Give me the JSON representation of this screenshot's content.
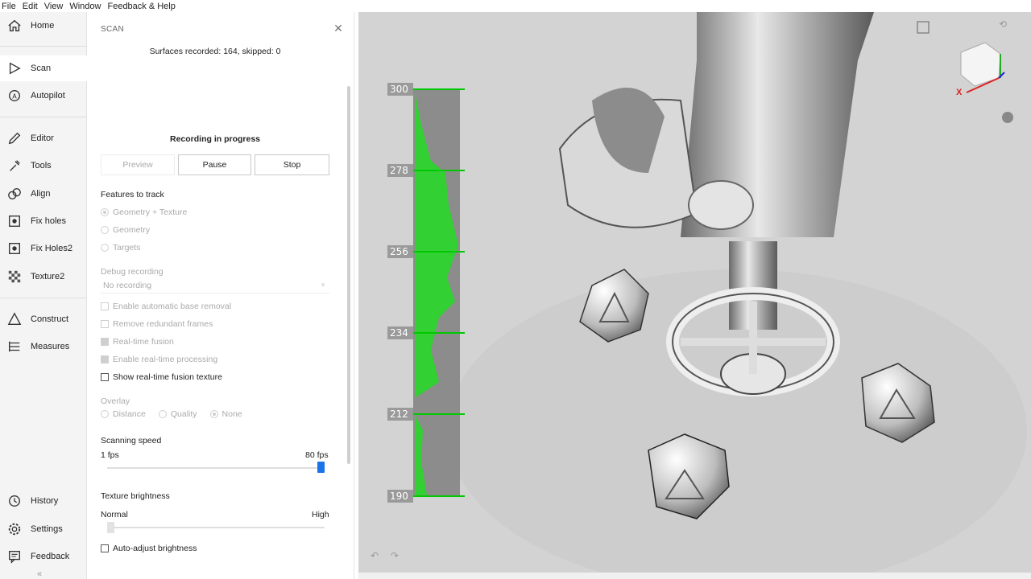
{
  "menu": {
    "file": "File",
    "edit": "Edit",
    "view": "View",
    "window": "Window",
    "help": "Feedback & Help"
  },
  "sidebar": {
    "items": [
      {
        "label": "Home",
        "icon": "home-icon"
      },
      {
        "label": "Scan",
        "icon": "play-icon"
      },
      {
        "label": "Autopilot",
        "icon": "autopilot-icon"
      },
      {
        "label": "Editor",
        "icon": "pencil-icon"
      },
      {
        "label": "Tools",
        "icon": "tools-icon"
      },
      {
        "label": "Align",
        "icon": "align-icon"
      },
      {
        "label": "Fix holes",
        "icon": "fix-holes-icon"
      },
      {
        "label": "Fix Holes2",
        "icon": "fix-holes2-icon"
      },
      {
        "label": "Texture2",
        "icon": "texture-icon"
      },
      {
        "label": "Construct",
        "icon": "construct-icon"
      },
      {
        "label": "Measures",
        "icon": "measures-icon"
      },
      {
        "label": "History",
        "icon": "history-icon"
      },
      {
        "label": "Settings",
        "icon": "gear-icon"
      },
      {
        "label": "Feedback",
        "icon": "feedback-icon"
      }
    ],
    "collapse": "«"
  },
  "panel": {
    "title": "SCAN",
    "surfaces": "Surfaces recorded: 164, skipped: 0",
    "status": "Recording in progress",
    "buttons": {
      "preview": "Preview",
      "pause": "Pause",
      "stop": "Stop"
    },
    "features_label": "Features to track",
    "features": [
      "Geometry + Texture",
      "Geometry",
      "Targets"
    ],
    "debug_label": "Debug recording",
    "debug_value": "No recording",
    "options": [
      {
        "label": "Enable automatic base removal",
        "checked": false,
        "enabled": false
      },
      {
        "label": "Remove redundant frames",
        "checked": false,
        "enabled": false
      },
      {
        "label": "Real-time fusion",
        "checked": true,
        "enabled": false
      },
      {
        "label": "Enable real-time processing",
        "checked": true,
        "enabled": false
      },
      {
        "label": "Show real-time fusion texture",
        "checked": false,
        "enabled": true
      }
    ],
    "overlay_label": "Overlay",
    "overlay_options": [
      "Distance",
      "Quality",
      "None"
    ],
    "overlay_selected": "None",
    "speed_label": "Scanning speed",
    "speed_min": "1 fps",
    "speed_max": "80 fps",
    "speed_value": 1.0,
    "brightness_label": "Texture brightness",
    "brightness_min": "Normal",
    "brightness_max": "High",
    "brightness_value": 0.0,
    "auto_brightness": "Auto-adjust brightness"
  },
  "viewport": {
    "gauge_ticks": [
      "300",
      "278",
      "256",
      "234",
      "212",
      "190"
    ],
    "accent": "#00c800",
    "axis_x": "X"
  }
}
